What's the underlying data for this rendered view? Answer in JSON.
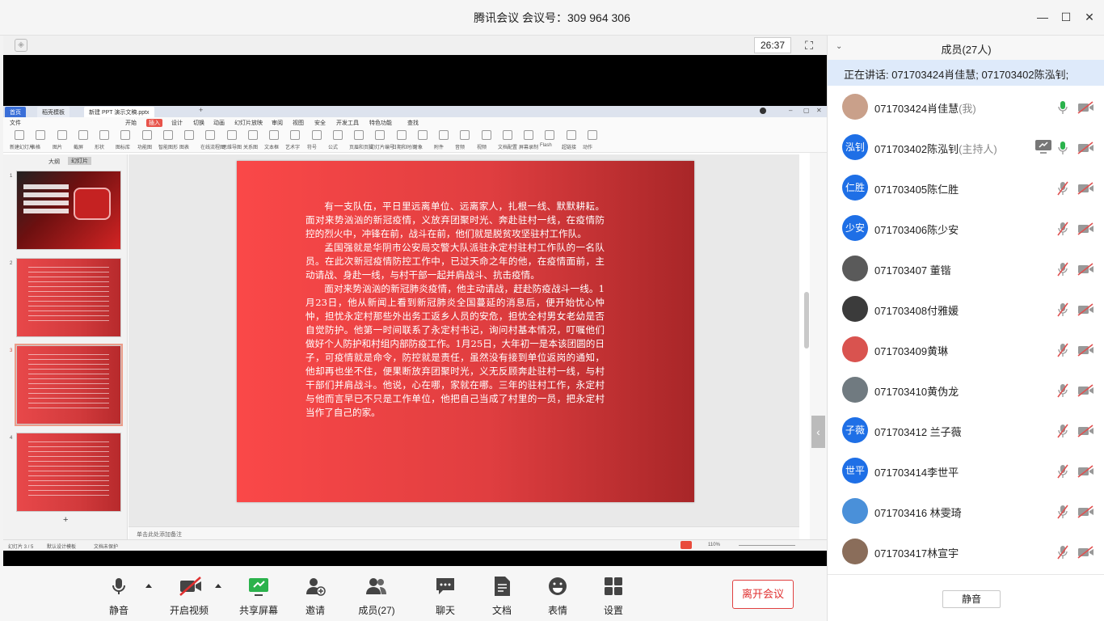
{
  "window": {
    "title": "腾讯会议 会议号：309 964 306",
    "minimize": "—",
    "maximize": "☐",
    "close": "✕"
  },
  "video": {
    "timer": "26:37"
  },
  "wps": {
    "tabs": [
      "首页",
      "稻壳模板",
      "新建 PPT 演示文稿.pptx"
    ],
    "menu": [
      "文件",
      "开始",
      "插入",
      "设计",
      "切换",
      "动画",
      "幻灯片放映",
      "审阅",
      "视图",
      "安全",
      "开发工具",
      "特色功能",
      "查找"
    ],
    "toolbar": [
      "新建幻灯片",
      "表格",
      "图片",
      "截屏",
      "形状",
      "图标库",
      "功能图",
      "智能图形",
      "图表",
      "在线流程图",
      "思维导图",
      "关系图",
      "文本框",
      "艺术字",
      "符号",
      "公式",
      "页眉和页脚",
      "幻灯片编号",
      "日期和时间",
      "对象",
      "附件",
      "音频",
      "视频",
      "文档配置",
      "屏幕录制",
      "Flash",
      "超链接",
      "动作"
    ],
    "outline_tab": "大纲",
    "slides_tab": "幻灯片",
    "thumb_numbers": [
      "1",
      "2",
      "3",
      "4"
    ],
    "notes_placeholder": "单击此处添加备注",
    "status_left": "幻灯片 3 / 5",
    "status_theme": "默认设计模板",
    "status_doc": "文档未保护",
    "zoom": "110%",
    "slide_paragraphs": [
      "有一支队伍，平日里远离单位、远离家人，扎根一线、默默耕耘。面对来势汹汹的新冠疫情，义放弃团聚时光、奔赴驻村一线，在疫情防控的烈火中，冲锋在前，战斗在前，他们就是脱贫攻坚驻村工作队。",
      "孟国强就是华阴市公安局交警大队派驻永定村驻村工作队的一名队员。在此次新冠疫情防控工作中，已过天命之年的他，在疫情面前，主动请战、身赴一线，与村干部一起并肩战斗、抗击疫情。",
      "面对来势汹汹的新冠肺炎疫情，他主动请战，赶赴防疫战斗一线。1月23日，他从新闻上看到新冠肺炎全国蔓延的消息后，便开始忧心忡忡，担忧永定村那些外出务工返乡人员的安危，担忧全村男女老幼是否自觉防护。他第一时间联系了永定村书记，询问村基本情况，叮嘱他们做好个人防护和村组内部防疫工作。1月25日，大年初一是本该团圆的日子，可疫情就是命令，防控就是责任，虽然没有接到单位返岗的通知，他却再也坐不住，便果断放弃团聚时光，义无反顾奔赴驻村一线，与村干部们并肩战斗。他说，心在哪，家就在哪。三年的驻村工作，永定村与他而言早已不只是工作单位，他把自己当成了村里的一员，把永定村当作了自己的家。"
    ]
  },
  "toolbar": {
    "mute": "静音",
    "video": "开启视频",
    "share": "共享屏幕",
    "invite": "邀请",
    "members": "成员(27)",
    "chat": "聊天",
    "docs": "文档",
    "emoji": "表情",
    "settings": "设置",
    "leave": "离开会议"
  },
  "panel": {
    "title": "成员(27人)",
    "speaking": "正在讲话: 071703424肖佳慧; 071703402陈泓钊;",
    "mute_all": "静音",
    "members": [
      {
        "name": "071703424肖佳慧",
        "role": "(我)",
        "avatar": "",
        "mic_on": true,
        "sharing": false
      },
      {
        "name": "071703402陈泓钊",
        "role": "(主持人)",
        "avatar": "泓钊",
        "mic_on": true,
        "sharing": true
      },
      {
        "name": "071703405陈仁胜",
        "role": "",
        "avatar": "仁胜",
        "mic_on": false,
        "sharing": false
      },
      {
        "name": "071703406陈少安",
        "role": "",
        "avatar": "少安",
        "mic_on": false,
        "sharing": false
      },
      {
        "name": "071703407 董锴",
        "role": "",
        "avatar": "",
        "mic_on": false,
        "sharing": false
      },
      {
        "name": "071703408付雅媛",
        "role": "",
        "avatar": "",
        "mic_on": false,
        "sharing": false
      },
      {
        "name": "071703409黄琳",
        "role": "",
        "avatar": "",
        "mic_on": false,
        "sharing": false
      },
      {
        "name": "071703410黄伪龙",
        "role": "",
        "avatar": "",
        "mic_on": false,
        "sharing": false
      },
      {
        "name": "071703412 兰子薇",
        "role": "",
        "avatar": "子薇",
        "mic_on": false,
        "sharing": false
      },
      {
        "name": "071703414李世平",
        "role": "",
        "avatar": "世平",
        "mic_on": false,
        "sharing": false
      },
      {
        "name": "071703416 林雯琦",
        "role": "",
        "avatar": "",
        "mic_on": false,
        "sharing": false
      },
      {
        "name": "071703417林宣宇",
        "role": "",
        "avatar": "",
        "mic_on": false,
        "sharing": false
      }
    ]
  },
  "colors": {
    "accent": "#1e6fe6",
    "leave": "#e03030",
    "speaking_bg": "#deeafa",
    "slide_red": "#e03e40",
    "mic_green": "#2bb24c"
  }
}
